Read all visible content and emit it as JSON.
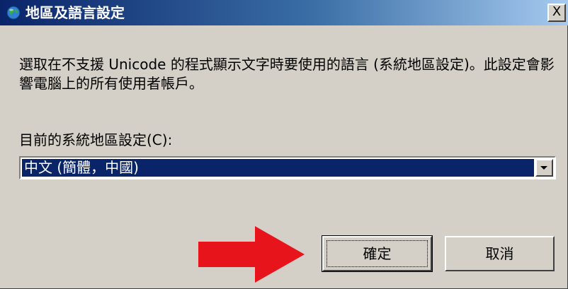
{
  "window": {
    "title": "地區及語言設定",
    "close_label": "X"
  },
  "dialog": {
    "description": "選取在不支援 Unicode 的程式顯示文字時要使用的語言 (系統地區設定)。此設定會影響電腦上的所有使用者帳戶。",
    "current_locale_label": "目前的系統地區設定(C):",
    "locale_value": "中文 (簡體，中國)"
  },
  "buttons": {
    "ok_label": "確定",
    "cancel_label": "取消"
  },
  "colors": {
    "selection": "#0a246a",
    "dialog_bg": "#d4d0c8",
    "annotation_arrow": "#e8141c"
  },
  "icons": {
    "title_icon": "globe-icon",
    "dropdown": "chevron-down-icon",
    "annotation": "red-arrow-icon"
  }
}
